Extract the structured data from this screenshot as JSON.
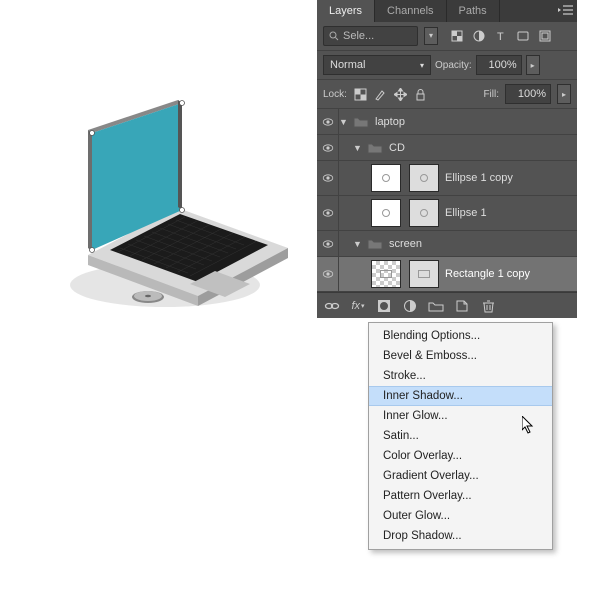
{
  "panel": {
    "tabs": [
      "Layers",
      "Channels",
      "Paths"
    ],
    "active_tab": 0,
    "search_placeholder": "Sele...",
    "blend_mode": "Normal",
    "opacity_label": "Opacity:",
    "opacity_value": "100%",
    "lock_label": "Lock:",
    "fill_label": "Fill:",
    "fill_value": "100%"
  },
  "layers": [
    {
      "type": "group",
      "name": "laptop",
      "depth": 0,
      "expanded": true
    },
    {
      "type": "group",
      "name": "CD",
      "depth": 1,
      "expanded": true
    },
    {
      "type": "shape",
      "name": "Ellipse 1 copy",
      "depth": 2,
      "shape": "ellipse"
    },
    {
      "type": "shape",
      "name": "Ellipse 1",
      "depth": 2,
      "shape": "ellipse"
    },
    {
      "type": "group",
      "name": "screen",
      "depth": 1,
      "expanded": true
    },
    {
      "type": "shape",
      "name": "Rectangle 1 copy",
      "depth": 2,
      "shape": "rect",
      "selected": true,
      "checker": true
    }
  ],
  "footer_icons": [
    "link-icon",
    "fx-icon",
    "mask-icon",
    "adjustment-icon",
    "group-icon",
    "new-layer-icon",
    "trash-icon"
  ],
  "context_menu": {
    "items": [
      "Blending Options...",
      "Bevel & Emboss...",
      "Stroke...",
      "Inner Shadow...",
      "Inner Glow...",
      "Satin...",
      "Color Overlay...",
      "Gradient Overlay...",
      "Pattern Overlay...",
      "Outer Glow...",
      "Drop Shadow..."
    ],
    "highlighted": 3
  }
}
